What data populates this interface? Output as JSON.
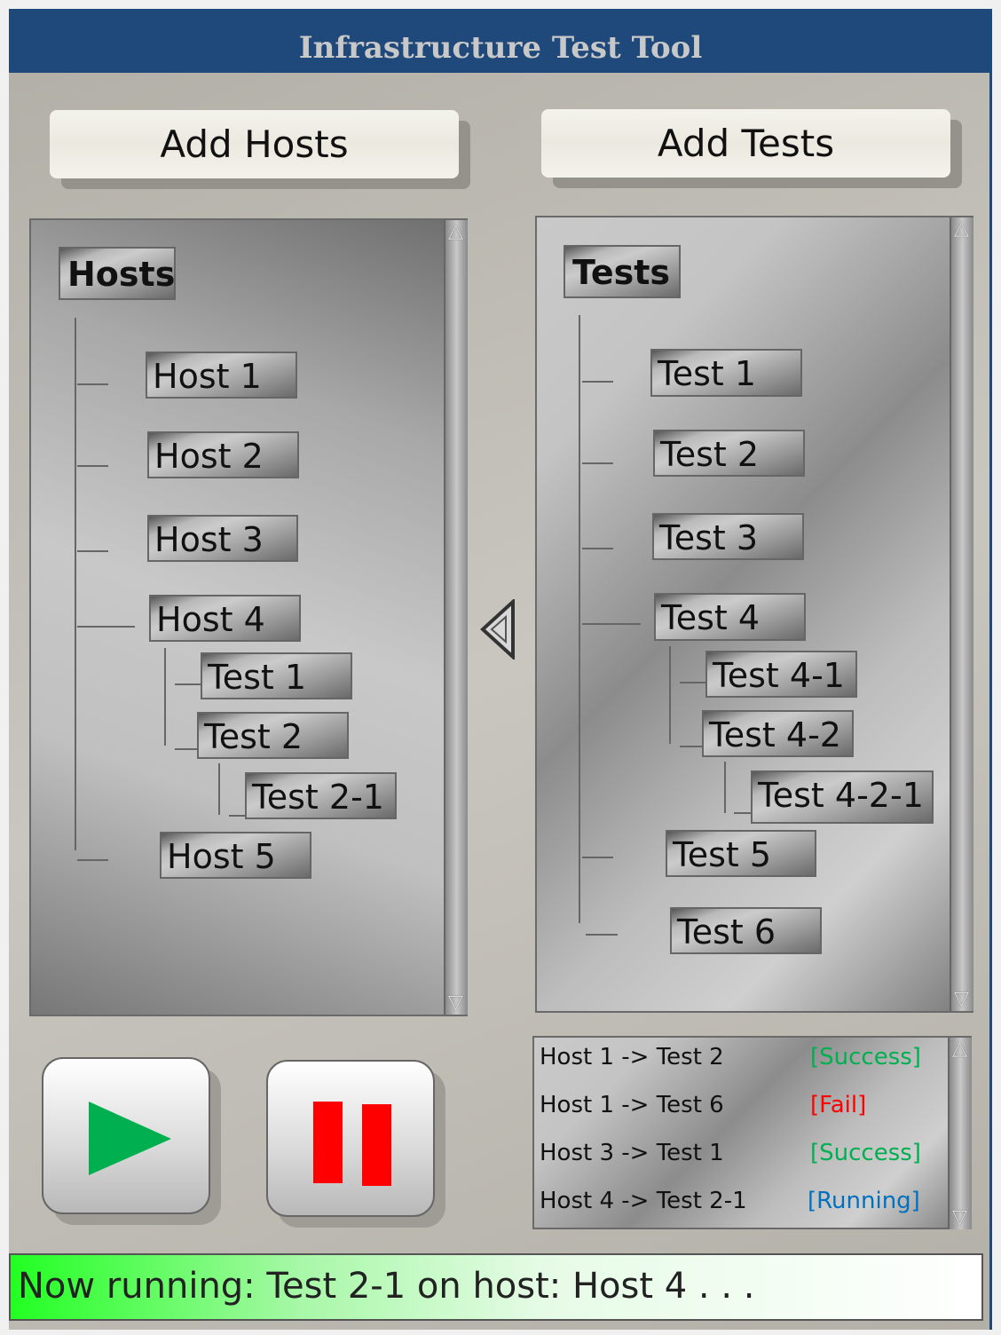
{
  "app": {
    "title": "Infrastructure Test Tool"
  },
  "toolbar": {
    "add_hosts": "Add Hosts",
    "add_tests": "Add Tests"
  },
  "hosts_tree": {
    "header": "Hosts",
    "nodes": [
      "Host 1",
      "Host 2",
      "Host 3",
      "Host 4",
      "Test 1",
      "Test 2",
      "Test 2-1",
      "Host 5"
    ]
  },
  "tests_tree": {
    "header": "Tests",
    "nodes": [
      "Test 1",
      "Test 2",
      "Test 3",
      "Test 4",
      "Test 4-1",
      "Test 4-2",
      "Test 4-2-1",
      "Test 5",
      "Test 6"
    ]
  },
  "log": [
    {
      "entry": "Host 1 -> Test 2",
      "status": "[Success]",
      "color": "#00b050"
    },
    {
      "entry": "Host 1 -> Test 6",
      "status": "[Fail]",
      "color": "#ff0000"
    },
    {
      "entry": "Host 3 -> Test 1",
      "status": "[Success]",
      "color": "#00b050"
    },
    {
      "entry": "Host 4 -> Test 2-1",
      "status": "[Running]",
      "color": "#0070c0"
    }
  ],
  "controls": {
    "play_icon": "play-icon",
    "pause_icon": "pause-icon",
    "assign_icon": "triangle-left-icon"
  },
  "status": {
    "text": "Now running: Test 2-1 on host: Host 4 . . ."
  },
  "colors": {
    "title_bar": "#20497b",
    "play": "#00b050",
    "pause": "#ff0000"
  }
}
